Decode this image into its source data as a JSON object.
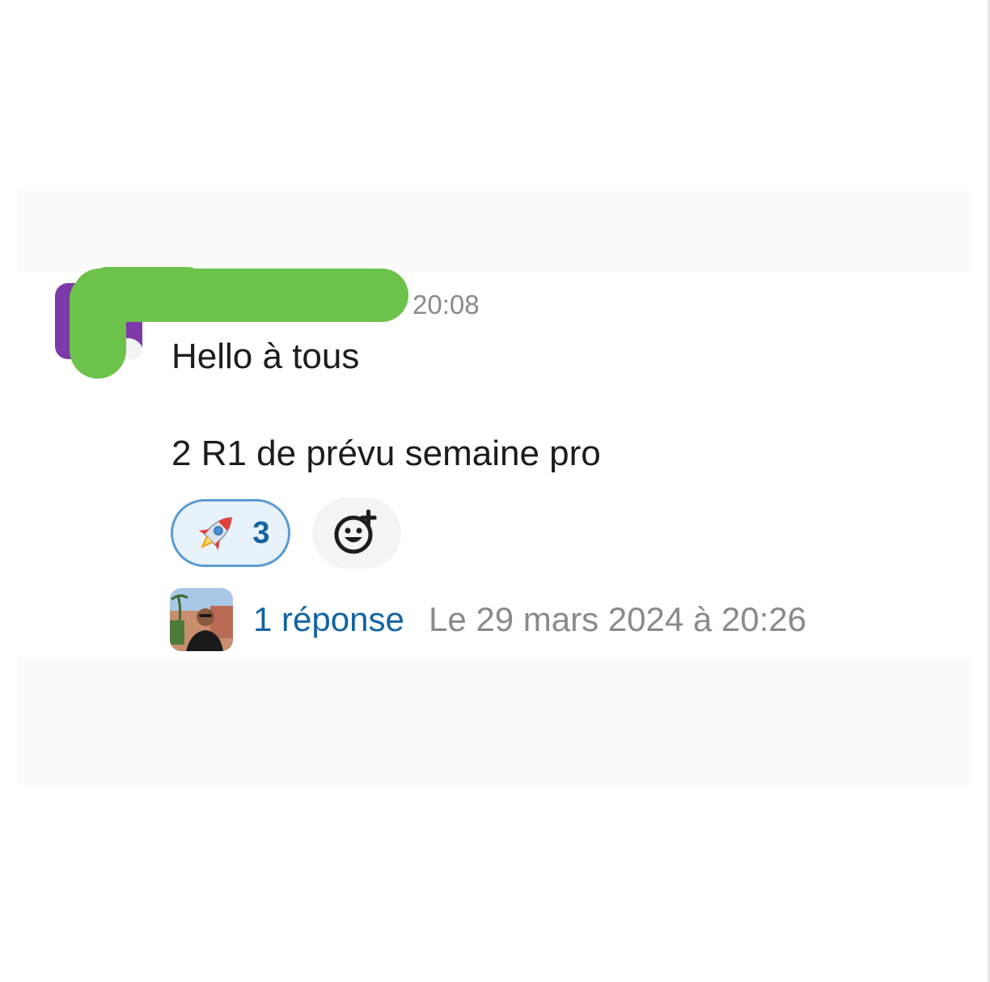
{
  "message": {
    "timestamp": "20:08",
    "lines": [
      "Hello à tous",
      "2 R1 de prévu semaine pro"
    ]
  },
  "reactions": [
    {
      "emoji": "rocket",
      "count": "3",
      "selected": true
    }
  ],
  "add_reaction": {
    "icon": "add-emoji-icon"
  },
  "thread": {
    "replies_label": "1 réponse",
    "last_reply": "Le 29 mars 2024 à 20:26"
  },
  "colors": {
    "link": "#1264a3",
    "reaction_border": "#5a9bd1",
    "reaction_bg": "#e8f2fb",
    "redaction": "#6cc24a",
    "avatar": "#7b3aa8",
    "muted": "#8a8a8a"
  }
}
